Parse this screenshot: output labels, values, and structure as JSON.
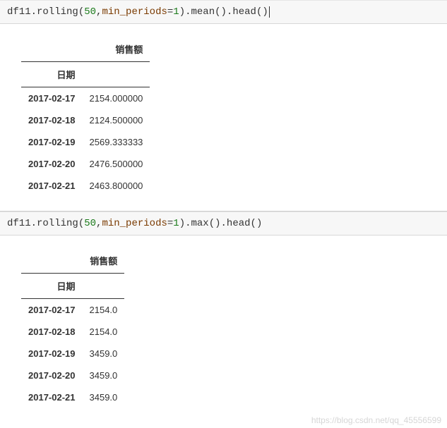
{
  "cells": [
    {
      "code_parts": {
        "p1": "df11.rolling",
        "lp1": "(",
        "n1": "50",
        "comma": ",",
        "kw": "min_periods",
        "eq": "=",
        "n2": "1",
        "rp1": ")",
        "m1": ".mean",
        "lp2": "(",
        "rp2": ")",
        "m2": ".head",
        "lp3": "(",
        "rp3": ")"
      },
      "show_cursor": true,
      "table": {
        "column_header": "销售额",
        "index_name": "日期",
        "rows": [
          {
            "idx": "2017-02-17",
            "val": "2154.000000"
          },
          {
            "idx": "2017-02-18",
            "val": "2124.500000"
          },
          {
            "idx": "2017-02-19",
            "val": "2569.333333"
          },
          {
            "idx": "2017-02-20",
            "val": "2476.500000"
          },
          {
            "idx": "2017-02-21",
            "val": "2463.800000"
          }
        ]
      }
    },
    {
      "code_parts": {
        "p1": "df11.rolling",
        "lp1": "(",
        "n1": "50",
        "comma": ",",
        "kw": "min_periods",
        "eq": "=",
        "n2": "1",
        "rp1": ")",
        "m1": ".max",
        "lp2": "(",
        "rp2": ")",
        "m2": ".head",
        "lp3": "(",
        "rp3": ")"
      },
      "show_cursor": false,
      "table": {
        "column_header": "销售额",
        "index_name": "日期",
        "rows": [
          {
            "idx": "2017-02-17",
            "val": "2154.0"
          },
          {
            "idx": "2017-02-18",
            "val": "2154.0"
          },
          {
            "idx": "2017-02-19",
            "val": "3459.0"
          },
          {
            "idx": "2017-02-20",
            "val": "3459.0"
          },
          {
            "idx": "2017-02-21",
            "val": "3459.0"
          }
        ]
      }
    }
  ],
  "watermark": "https://blog.csdn.net/qq_45556599"
}
